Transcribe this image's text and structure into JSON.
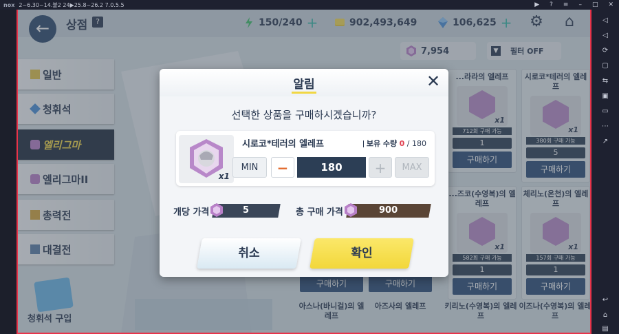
{
  "emulator": {
    "logo": "nox",
    "status": "2~6.30~14.불2 24▶25.8~26.2 7.0.5.5"
  },
  "shop": {
    "title": "상점",
    "help_label": "?",
    "resources": {
      "stamina": "150/240",
      "credits": "902,493,649",
      "gems": "106,625"
    },
    "eligma_count": "7,954",
    "filter_label": "필터 OFF"
  },
  "sidebar": {
    "items": [
      {
        "label": "일반"
      },
      {
        "label": "청휘석"
      },
      {
        "label": "엘리그마"
      },
      {
        "label": "엘리그마II"
      },
      {
        "label": "총력전"
      },
      {
        "label": "대결전"
      }
    ],
    "bottom_label": "청휘석 구입"
  },
  "cards": [
    {
      "title": "...라라의 엘레프",
      "sub": "712회 구매 가능",
      "count": "1",
      "buy": "구매하기",
      "qty": "x1"
    },
    {
      "title": "시로코*테러의 엘레프",
      "sub": "380회 구매 가능",
      "count": "5",
      "buy": "구매하기",
      "qty": "x1"
    },
    {
      "title": "...즈코(수영복)의 엘레프",
      "sub": "582회 구매 가능",
      "count": "1",
      "buy": "구매하기",
      "qty": "x1"
    },
    {
      "title": "체리노(온천)의 엘레프",
      "sub": "157회 구매 가능",
      "count": "1",
      "buy": "구매하기",
      "qty": "x1"
    }
  ],
  "bottom_buy": [
    "구매하기",
    "구매하기"
  ],
  "bottom_names": [
    "아스나(바니걸)의 엘레프",
    "아즈사의 엘레프",
    "키리노(수영복)의 엘레프",
    "이즈나(수영복)의 엘레프"
  ],
  "dialog": {
    "title": "알림",
    "question": "선택한 상품을 구매하시겠습니까?",
    "item_name": "시로코*테러의 엘레프",
    "item_qty": "x1",
    "own_label": "보유 수량",
    "own_value": "0",
    "own_max": "/ 180",
    "min_label": "MIN",
    "minus_label": "−",
    "quantity": "180",
    "plus_label": "+",
    "max_label": "MAX",
    "unit_price_label": "개당 가격",
    "unit_price": "5",
    "total_price_label": "총 구매 가격",
    "total_price": "900",
    "cancel_label": "취소",
    "confirm_label": "확인"
  },
  "colors": {
    "accent_yellow": "#f1d743",
    "navy": "#2c3e55",
    "brown": "#5a4536",
    "red_border": "#e8344a"
  }
}
